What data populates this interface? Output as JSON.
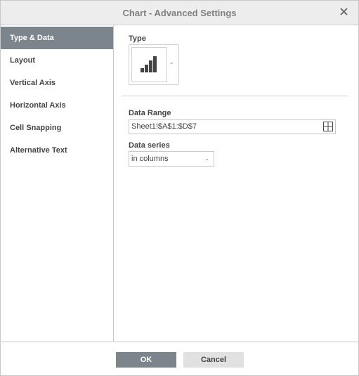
{
  "dialog": {
    "title": "Chart - Advanced Settings",
    "close_icon": "close-icon"
  },
  "sidebar": {
    "items": [
      {
        "label": "Type & Data",
        "active": true
      },
      {
        "label": "Layout",
        "active": false
      },
      {
        "label": "Vertical Axis",
        "active": false
      },
      {
        "label": "Horizontal Axis",
        "active": false
      },
      {
        "label": "Cell Snapping",
        "active": false
      },
      {
        "label": "Alternative Text",
        "active": false
      }
    ]
  },
  "content": {
    "type_label": "Type",
    "type_icon": "bar-chart-icon",
    "data_range_label": "Data Range",
    "data_range_value": "Sheet1!$A$1:$D$7",
    "data_range_button_icon": "select-range-grid-icon",
    "data_series_label": "Data series",
    "data_series_value": "in columns"
  },
  "footer": {
    "ok_label": "OK",
    "cancel_label": "Cancel"
  },
  "colors": {
    "accent": "#7d858c",
    "header_bg": "#ededed",
    "text": "#444444"
  }
}
